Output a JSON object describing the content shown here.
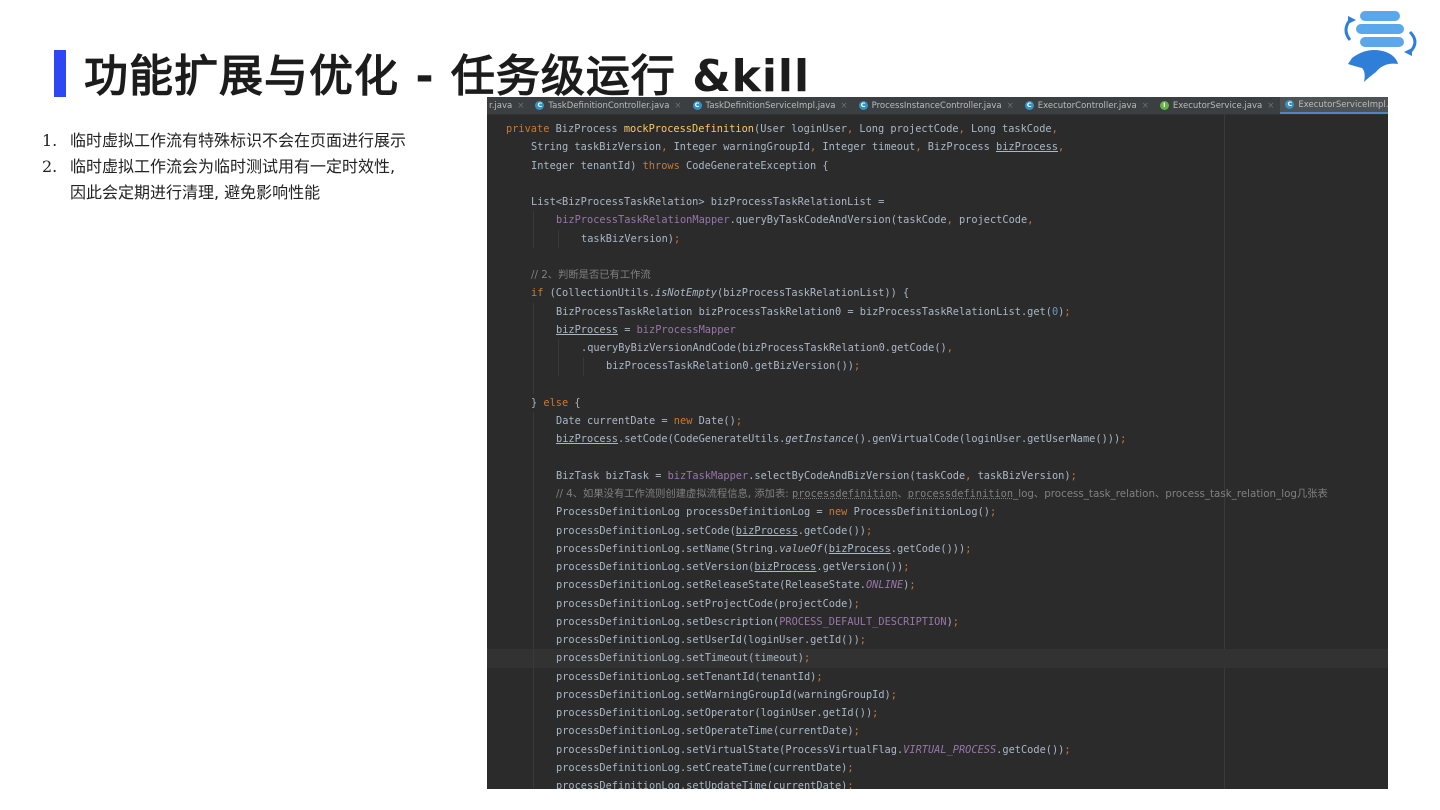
{
  "slide": {
    "title": "功能扩展与优化 - 任务级运行 &kill",
    "accent_color": "#2e47f0",
    "logo_icon": "dolphinscheduler-logo-icon",
    "notes": [
      {
        "num": "1.",
        "text": "临时虚拟工作流有特殊标识不会在页面进行展示"
      },
      {
        "num": "2.",
        "text": "临时虚拟工作流会为临时测试用有一定时效性,"
      },
      {
        "num": "",
        "text": "因此会定期进行清理, 避免影响性能"
      }
    ]
  },
  "ide": {
    "background": "#2b2b2b",
    "tabs": [
      {
        "label": "r.java",
        "icon": "",
        "active": false
      },
      {
        "label": "TaskDefinitionController.java",
        "icon": "C",
        "active": false
      },
      {
        "label": "TaskDefinitionServiceImpl.java",
        "icon": "C",
        "active": false
      },
      {
        "label": "ProcessInstanceController.java",
        "icon": "C",
        "active": false
      },
      {
        "label": "ExecutorController.java",
        "icon": "C",
        "active": false
      },
      {
        "label": "ExecutorService.java",
        "icon": "I",
        "active": false
      },
      {
        "label": "ExecutorServiceImpl.java",
        "icon": "C",
        "active": true
      }
    ],
    "close_glyph": "×",
    "code_lines": [
      {
        "indent": 0,
        "guides": 0,
        "hl": false,
        "t": [
          [
            "k",
            "private "
          ],
          [
            "",
            "BizProcess "
          ],
          [
            "f",
            "mockProcessDefinition"
          ],
          [
            "",
            "(User loginUser"
          ],
          [
            "k",
            ", "
          ],
          [
            "",
            "Long projectCode"
          ],
          [
            "k",
            ", "
          ],
          [
            "",
            "Long taskCode"
          ],
          [
            "k",
            ","
          ]
        ]
      },
      {
        "indent": 1,
        "guides": 0,
        "hl": false,
        "t": [
          [
            "",
            "String taskBizVersion"
          ],
          [
            "k",
            ", "
          ],
          [
            "",
            "Integer warningGroupId"
          ],
          [
            "k",
            ", "
          ],
          [
            "",
            "Integer timeout"
          ],
          [
            "k",
            ", "
          ],
          [
            "",
            "BizProcess "
          ],
          [
            "u",
            "bizProcess"
          ],
          [
            "k",
            ","
          ]
        ]
      },
      {
        "indent": 1,
        "guides": 0,
        "hl": false,
        "t": [
          [
            "",
            "Integer tenantId) "
          ],
          [
            "k",
            "throws "
          ],
          [
            "",
            "CodeGenerateException {"
          ]
        ]
      },
      {
        "indent": 0,
        "guides": 0,
        "hl": false,
        "t": []
      },
      {
        "indent": 1,
        "guides": 0,
        "hl": false,
        "t": [
          [
            "",
            "List<BizProcessTaskRelation> bizProcessTaskRelationList = "
          ]
        ]
      },
      {
        "indent": 2,
        "guides": 1,
        "hl": false,
        "t": [
          [
            "m",
            "bizProcessTaskRelationMapper"
          ],
          [
            "",
            ".queryByTaskCodeAndVersion(taskCode"
          ],
          [
            "k",
            ", "
          ],
          [
            "",
            "projectCode"
          ],
          [
            "k",
            ","
          ]
        ]
      },
      {
        "indent": 3,
        "guides": 2,
        "hl": false,
        "t": [
          [
            "",
            "taskBizVersion)"
          ],
          [
            "k",
            ";"
          ]
        ]
      },
      {
        "indent": 0,
        "guides": 0,
        "hl": false,
        "t": []
      },
      {
        "indent": 1,
        "guides": 0,
        "hl": false,
        "t": [
          [
            "c",
            "// 2、判断是否已有工作流"
          ]
        ]
      },
      {
        "indent": 1,
        "guides": 0,
        "hl": false,
        "t": [
          [
            "k",
            "if "
          ],
          [
            "",
            "(CollectionUtils."
          ],
          [
            "it",
            "isNotEmpty"
          ],
          [
            "",
            "(bizProcessTaskRelationList)) {"
          ]
        ]
      },
      {
        "indent": 2,
        "guides": 1,
        "hl": false,
        "t": [
          [
            "",
            "BizProcessTaskRelation bizProcessTaskRelation0 = bizProcessTaskRelationList.get("
          ],
          [
            "n",
            "0"
          ],
          [
            "",
            ")"
          ],
          [
            "k",
            ";"
          ]
        ]
      },
      {
        "indent": 2,
        "guides": 1,
        "hl": false,
        "t": [
          [
            "u",
            "bizProcess"
          ],
          [
            "",
            " = "
          ],
          [
            "m",
            "bizProcessMapper"
          ]
        ]
      },
      {
        "indent": 3,
        "guides": 2,
        "hl": false,
        "t": [
          [
            "",
            ".queryByBizVersionAndCode(bizProcessTaskRelation0.getCode()"
          ],
          [
            "k",
            ","
          ]
        ]
      },
      {
        "indent": 4,
        "guides": 3,
        "hl": false,
        "t": [
          [
            "",
            "bizProcessTaskRelation0.getBizVersion())"
          ],
          [
            "k",
            ";"
          ]
        ]
      },
      {
        "indent": 0,
        "guides": 1,
        "hl": false,
        "t": []
      },
      {
        "indent": 1,
        "guides": 0,
        "hl": false,
        "t": [
          [
            "",
            "} "
          ],
          [
            "k",
            "else "
          ],
          [
            "",
            "{"
          ]
        ]
      },
      {
        "indent": 2,
        "guides": 1,
        "hl": false,
        "t": [
          [
            "",
            "Date currentDate = "
          ],
          [
            "k",
            "new "
          ],
          [
            "",
            "Date()"
          ],
          [
            "k",
            ";"
          ]
        ]
      },
      {
        "indent": 2,
        "guides": 1,
        "hl": false,
        "t": [
          [
            "u",
            "bizProcess"
          ],
          [
            "",
            ".setCode(CodeGenerateUtils."
          ],
          [
            "it",
            "getInstance"
          ],
          [
            "",
            "().genVirtualCode(loginUser.getUserName()))"
          ],
          [
            "k",
            ";"
          ]
        ]
      },
      {
        "indent": 0,
        "guides": 1,
        "hl": false,
        "t": []
      },
      {
        "indent": 2,
        "guides": 1,
        "hl": false,
        "t": [
          [
            "",
            "BizTask bizTask = "
          ],
          [
            "m",
            "bizTaskMapper"
          ],
          [
            "",
            ".selectByCodeAndBizVersion(taskCode"
          ],
          [
            "k",
            ", "
          ],
          [
            "",
            "taskBizVersion)"
          ],
          [
            "k",
            ";"
          ]
        ]
      },
      {
        "indent": 2,
        "guides": 1,
        "hl": false,
        "t": [
          [
            "c",
            "// 4、如果没有工作流则创建虚拟流程信息, 添加表: "
          ],
          [
            "cw",
            "processdefinition"
          ],
          [
            "c",
            "、"
          ],
          [
            "cw",
            "processdefinition"
          ],
          [
            "c",
            "_log、process_task_relation、process_task_relation_log几张表"
          ]
        ]
      },
      {
        "indent": 2,
        "guides": 1,
        "hl": false,
        "t": [
          [
            "",
            "ProcessDefinitionLog processDefinitionLog = "
          ],
          [
            "k",
            "new "
          ],
          [
            "",
            "ProcessDefinitionLog()"
          ],
          [
            "k",
            ";"
          ]
        ]
      },
      {
        "indent": 2,
        "guides": 1,
        "hl": false,
        "t": [
          [
            "",
            "processDefinitionLog.setCode("
          ],
          [
            "u",
            "bizProcess"
          ],
          [
            "",
            ".getCode())"
          ],
          [
            "k",
            ";"
          ]
        ]
      },
      {
        "indent": 2,
        "guides": 1,
        "hl": false,
        "t": [
          [
            "",
            "processDefinitionLog.setName(String."
          ],
          [
            "it",
            "valueOf"
          ],
          [
            "",
            "("
          ],
          [
            "u",
            "bizProcess"
          ],
          [
            "",
            ".getCode()))"
          ],
          [
            "k",
            ";"
          ]
        ]
      },
      {
        "indent": 2,
        "guides": 1,
        "hl": false,
        "t": [
          [
            "",
            "processDefinitionLog.setVersion("
          ],
          [
            "u",
            "bizProcess"
          ],
          [
            "",
            ".getVersion())"
          ],
          [
            "k",
            ";"
          ]
        ]
      },
      {
        "indent": 2,
        "guides": 1,
        "hl": false,
        "t": [
          [
            "",
            "processDefinitionLog.setReleaseState(ReleaseState."
          ],
          [
            "mi",
            "ONLINE"
          ],
          [
            "",
            ")"
          ],
          [
            "k",
            ";"
          ]
        ]
      },
      {
        "indent": 2,
        "guides": 1,
        "hl": false,
        "t": [
          [
            "",
            "processDefinitionLog.setProjectCode(projectCode)"
          ],
          [
            "k",
            ";"
          ]
        ]
      },
      {
        "indent": 2,
        "guides": 1,
        "hl": false,
        "t": [
          [
            "",
            "processDefinitionLog.setDescription("
          ],
          [
            "m",
            "PROCESS_DEFAULT_DESCRIPTION"
          ],
          [
            "",
            ")"
          ],
          [
            "k",
            ";"
          ]
        ]
      },
      {
        "indent": 2,
        "guides": 1,
        "hl": false,
        "t": [
          [
            "",
            "processDefinitionLog.setUserId(loginUser.getId())"
          ],
          [
            "k",
            ";"
          ]
        ]
      },
      {
        "indent": 2,
        "guides": 1,
        "hl": true,
        "t": [
          [
            "",
            "processDefinitionLog.setTimeout(timeout)"
          ],
          [
            "k",
            ";"
          ]
        ]
      },
      {
        "indent": 2,
        "guides": 1,
        "hl": false,
        "t": [
          [
            "",
            "processDefinitionLog.setTenantId(tenantId)"
          ],
          [
            "k",
            ";"
          ]
        ]
      },
      {
        "indent": 2,
        "guides": 1,
        "hl": false,
        "t": [
          [
            "",
            "processDefinitionLog.setWarningGroupId(warningGroupId)"
          ],
          [
            "k",
            ";"
          ]
        ]
      },
      {
        "indent": 2,
        "guides": 1,
        "hl": false,
        "t": [
          [
            "",
            "processDefinitionLog.setOperator(loginUser.getId())"
          ],
          [
            "k",
            ";"
          ]
        ]
      },
      {
        "indent": 2,
        "guides": 1,
        "hl": false,
        "t": [
          [
            "",
            "processDefinitionLog.setOperateTime(currentDate)"
          ],
          [
            "k",
            ";"
          ]
        ]
      },
      {
        "indent": 2,
        "guides": 1,
        "hl": false,
        "t": [
          [
            "",
            "processDefinitionLog.setVirtualState(ProcessVirtualFlag."
          ],
          [
            "mi",
            "VIRTUAL_PROCESS"
          ],
          [
            "",
            ".getCode())"
          ],
          [
            "k",
            ";"
          ]
        ]
      },
      {
        "indent": 2,
        "guides": 1,
        "hl": false,
        "t": [
          [
            "",
            "processDefinitionLog.setCreateTime(currentDate)"
          ],
          [
            "k",
            ";"
          ]
        ]
      },
      {
        "indent": 2,
        "guides": 1,
        "hl": false,
        "t": [
          [
            "",
            "processDefinitionLog.setUpdateTime(currentDate)"
          ],
          [
            "k",
            ";"
          ]
        ]
      }
    ]
  }
}
